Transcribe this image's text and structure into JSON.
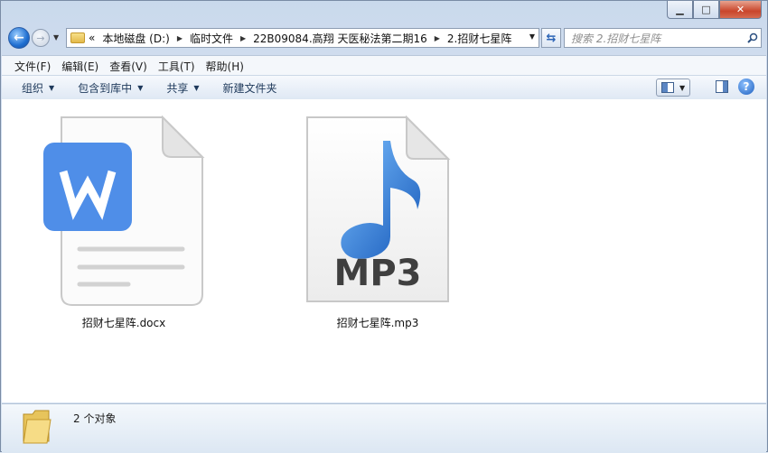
{
  "address": {
    "overflow": "«",
    "breadcrumbs": [
      "本地磁盘 (D:)",
      "临时文件",
      "22B09084.高翔 天医秘法第二期16",
      "2.招财七星阵"
    ]
  },
  "search": {
    "placeholder": "搜索 2.招财七星阵"
  },
  "menu": [
    "文件(F)",
    "编辑(E)",
    "查看(V)",
    "工具(T)",
    "帮助(H)"
  ],
  "commands": {
    "organize": "组织",
    "include": "包含到库中",
    "share": "共享",
    "new_folder": "新建文件夹"
  },
  "files": [
    {
      "name": "招财七星阵.docx",
      "icon": "wps-word-document-icon"
    },
    {
      "name": "招财七星阵.mp3",
      "icon": "mp3-file-icon",
      "badge": "MP3"
    }
  ],
  "status": {
    "count": "2 个对象"
  },
  "colors": {
    "wps_blue": "#4f8ee8",
    "note_blue": "#1c6fd0"
  }
}
